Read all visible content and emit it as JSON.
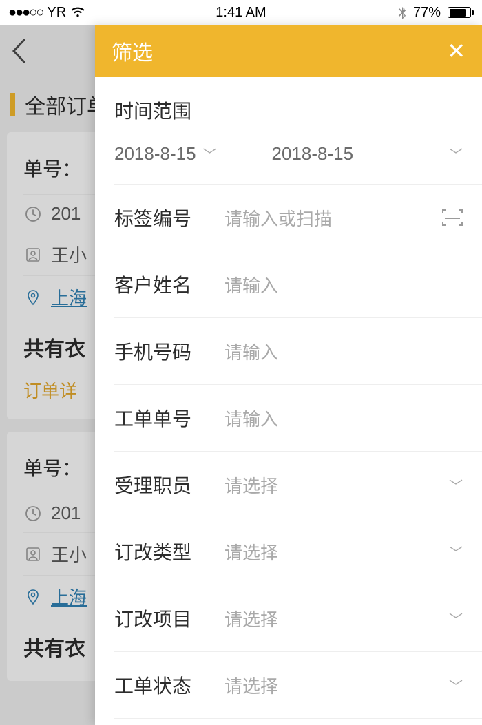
{
  "statusbar": {
    "carrier": "YR",
    "time": "1:41 AM",
    "battery_pct": "77%"
  },
  "background": {
    "section_title": "全部订单",
    "card": {
      "order_no_label": "单号：",
      "date_prefix": "201",
      "name_prefix": "王小",
      "addr_prefix": "上海",
      "summary_prefix": "共有衣",
      "detail_label": "订单详"
    }
  },
  "drawer": {
    "title": "筛选",
    "time_range_label": "时间范围",
    "date_from": "2018-8-15",
    "date_to": "2018-8-15",
    "rows": [
      {
        "label": "标签编号",
        "placeholder": "请输入或扫描",
        "action": "scan"
      },
      {
        "label": "客户姓名",
        "placeholder": "请输入",
        "action": "none"
      },
      {
        "label": "手机号码",
        "placeholder": "请输入",
        "action": "none"
      },
      {
        "label": "工单单号",
        "placeholder": "请输入",
        "action": "none"
      },
      {
        "label": "受理职员",
        "placeholder": "请选择",
        "action": "chevron"
      },
      {
        "label": "订改类型",
        "placeholder": "请选择",
        "action": "chevron"
      },
      {
        "label": "订改项目",
        "placeholder": "请选择",
        "action": "chevron"
      },
      {
        "label": "工单状态",
        "placeholder": "请选择",
        "action": "chevron"
      }
    ]
  }
}
